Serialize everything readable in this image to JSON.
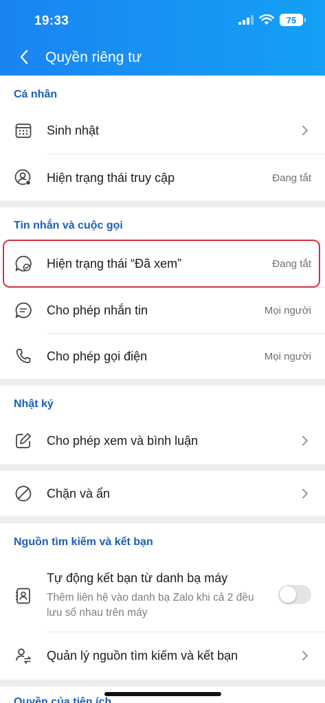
{
  "status_bar": {
    "time": "19:33",
    "battery": "75"
  },
  "header": {
    "title": "Quyền riêng tư"
  },
  "sections": {
    "personal": {
      "title": "Cá nhân",
      "birthday": "Sinh nhật",
      "online_status": {
        "label": "Hiện trạng thái truy cập",
        "value": "Đang tắt"
      }
    },
    "messages_calls": {
      "title": "Tin nhắn và cuộc gọi",
      "seen_status": {
        "label": "Hiện trạng thái “Đã xem”",
        "value": "Đang tắt"
      },
      "allow_messaging": {
        "label": "Cho phép nhắn tin",
        "value": "Mọi người"
      },
      "allow_calling": {
        "label": "Cho phép gọi điện",
        "value": "Mọi người"
      }
    },
    "diary": {
      "title": "Nhật ký",
      "view_comment": "Cho phép xem và bình luận"
    },
    "block_hide": {
      "label": "Chặn và ẩn"
    },
    "sources": {
      "title": "Nguồn tìm kiếm và kết bạn",
      "auto_add": {
        "label": "Tự động kết bạn từ danh bạ máy",
        "description": "Thêm liên hệ vào danh bạ Zalo khi cả 2 đều lưu số nhau trên máy",
        "enabled": false
      },
      "manage": "Quản lý nguồn tìm kiếm và kết bạn"
    },
    "next": {
      "title": "Quyền của tiện ích"
    }
  },
  "colors": {
    "header_start": "#1a84f2",
    "header_end": "#14a0f6",
    "section_title": "#1b5fb8",
    "highlight": "#d3313c"
  }
}
